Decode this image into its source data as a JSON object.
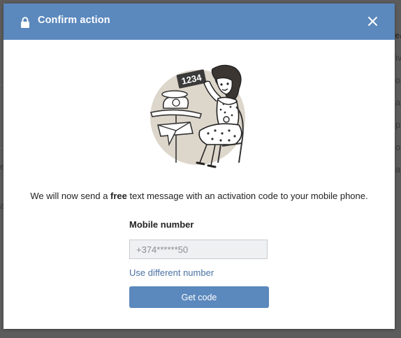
{
  "background": {
    "snippets": [
      "ea",
      "iv",
      "o",
      "a",
      "p",
      "o",
      "ay",
      "e",
      "a"
    ]
  },
  "dialog": {
    "title": "Confirm action",
    "lock_icon": "lock-icon",
    "close_icon": "close-icon",
    "illustration": "woman-with-phone-and-code-illustration",
    "illustration_code_text": "1234",
    "message_prefix": "We will now send a ",
    "message_bold": "free",
    "message_suffix": " text message with an activation code to your mobile phone.",
    "mobile_label": "Mobile number",
    "mobile_value": "+374******50",
    "use_different_label": "Use different number",
    "get_code_label": "Get code"
  },
  "colors": {
    "header": "#5b88bd",
    "button": "#5b88bd",
    "link": "#4a72a4",
    "backdrop": "#5c5c5c"
  }
}
